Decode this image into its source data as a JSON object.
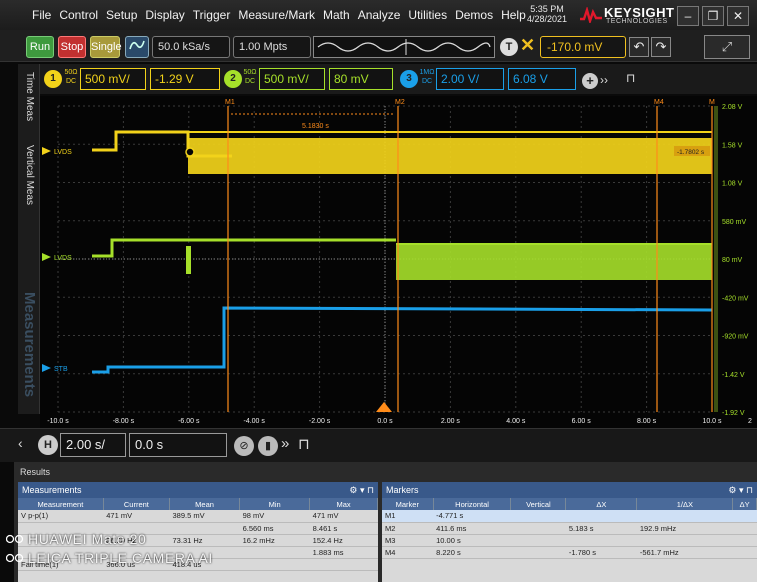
{
  "menu": [
    "File",
    "Control",
    "Setup",
    "Display",
    "Trigger",
    "Measure/Mark",
    "Math",
    "Analyze",
    "Utilities",
    "Demos",
    "Help"
  ],
  "clock": {
    "time": "5:35 PM",
    "date": "4/28/2021"
  },
  "brand": {
    "name": "KEYSIGHT",
    "sub": "TECHNOLOGIES",
    "color": "#e0182b"
  },
  "toolbar": {
    "run_label": "Run",
    "stop_label": "Stop",
    "single_label": "Single",
    "sample_rate": "50.0 kSa/s",
    "memory_depth": "1.00 Mpts",
    "trigger_btn": "T",
    "trigger_level": "-170.0 mV"
  },
  "left_tabs": [
    "Time Meas",
    "Vertical Meas",
    "Measurements"
  ],
  "channels": [
    {
      "num": "1",
      "coupling": "50Ω DC",
      "scale": "500 mV/",
      "offset": "-1.29 V",
      "color": "#f2d21a"
    },
    {
      "num": "2",
      "coupling": "50Ω DC",
      "scale": "500 mV/",
      "offset": "80 mV",
      "color": "#a6e02a"
    },
    {
      "num": "3",
      "coupling": "1MΩ DC",
      "scale": "2.00 V/",
      "offset": "6.08 V",
      "color": "#1a9fe8"
    }
  ],
  "plot": {
    "marker_labels": [
      "M1",
      "M2",
      "M4",
      "M"
    ],
    "delta_label": "5.1830 s",
    "trace_labels": [
      "LVDS",
      "LVDS",
      "STB"
    ],
    "readout": "-1.7802 s",
    "x_ticks": [
      "-10.0 s",
      "-8.00 s",
      "-6.00 s",
      "-4.00 s",
      "-2.00 s",
      "0.0 s",
      "2.00 s",
      "4.00 s",
      "6.00 s",
      "8.00 s",
      "10.0 s"
    ],
    "y_ticks": [
      "2.08 V",
      "1.58 V",
      "1.08 V",
      "580 mV",
      "80 mV",
      "-420 mV",
      "-920 mV",
      "-1.42 V",
      "-1.92 V"
    ],
    "corner": "2"
  },
  "timebase": {
    "badge": "H",
    "scale": "2.00 s/",
    "position": "0.0 s"
  },
  "results": {
    "title": "Results",
    "measurements_title": "Measurements",
    "meas_headers": [
      "Measurement",
      "Current",
      "Mean",
      "Min",
      "Max"
    ],
    "meas_rows": [
      [
        "V p-p(1)",
        "471 mV",
        "389.5 mV",
        "98 mV",
        "471 mV"
      ],
      [
        "",
        "",
        "",
        "6.560 ms",
        "8.461 s"
      ],
      [
        "",
        "86.20 Hz",
        "73.31 Hz",
        "16.2 mHz",
        "152.4 Hz"
      ],
      [
        "",
        "",
        "",
        "",
        "1.883 ms"
      ],
      [
        "Fall time(1)",
        "366.0 us",
        "418.4 us",
        "",
        ""
      ]
    ],
    "markers_title": "Markers",
    "mark_headers": [
      "Marker",
      "Horizontal",
      "Vertical",
      "ΔX",
      "1/ΔX",
      "ΔY"
    ],
    "mark_rows": [
      [
        "M1",
        "-4.771 s",
        "",
        "",
        "",
        ""
      ],
      [
        "M2",
        "411.6 ms",
        "",
        "5.183 s",
        "192.9 mHz",
        ""
      ],
      [
        "M3",
        "10.00 s",
        "",
        "",
        "",
        ""
      ],
      [
        "M4",
        "8.220 s",
        "",
        "-1.780 s",
        "-561.7 mHz",
        ""
      ]
    ]
  },
  "watermark": {
    "line1": "HUAWEI Mate 20",
    "line2": "LEICA TRIPLE CAMERA AI"
  }
}
